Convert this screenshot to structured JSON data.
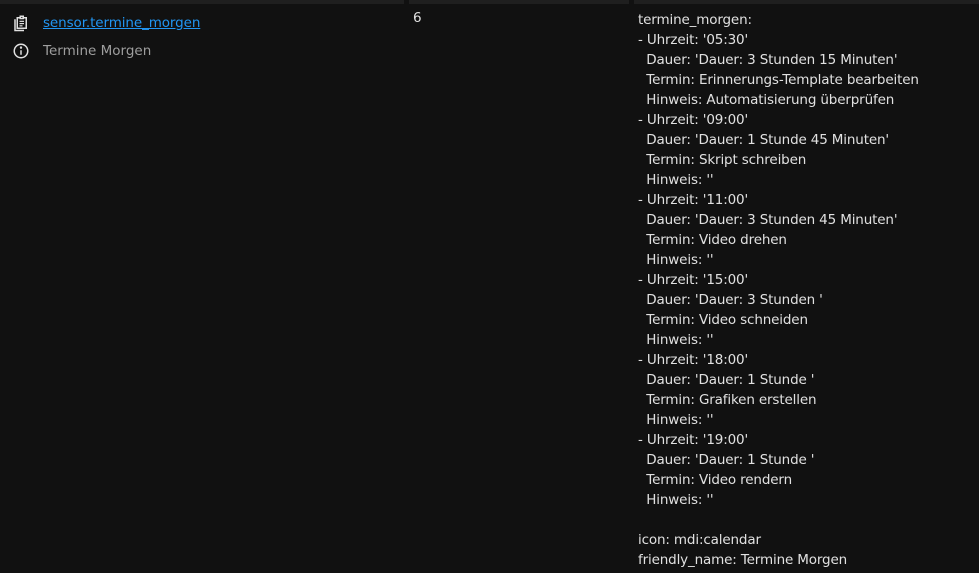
{
  "entity": {
    "id": "sensor.termine_morgen",
    "friendly_name": "Termine Morgen",
    "id_icon": "clipboard-list-icon",
    "name_icon": "info-circle-icon"
  },
  "state": "6",
  "attributes": {
    "lines": [
      "termine_morgen:",
      "- Uhrzeit: '05:30'",
      "  Dauer: 'Dauer: 3 Stunden 15 Minuten'",
      "  Termin: Erinnerungs-Template bearbeiten",
      "  Hinweis: Automatisierung überprüfen",
      "- Uhrzeit: '09:00'",
      "  Dauer: 'Dauer: 1 Stunde 45 Minuten'",
      "  Termin: Skript schreiben",
      "  Hinweis: ''",
      "- Uhrzeit: '11:00'",
      "  Dauer: 'Dauer: 3 Stunden 45 Minuten'",
      "  Termin: Video drehen",
      "  Hinweis: ''",
      "- Uhrzeit: '15:00'",
      "  Dauer: 'Dauer: 3 Stunden '",
      "  Termin: Video schneiden",
      "  Hinweis: ''",
      "- Uhrzeit: '18:00'",
      "  Dauer: 'Dauer: 1 Stunde '",
      "  Termin: Grafiken erstellen",
      "  Hinweis: ''",
      "- Uhrzeit: '19:00'",
      "  Dauer: 'Dauer: 1 Stunde '",
      "  Termin: Video rendern",
      "  Hinweis: ''",
      "",
      "icon: mdi:calendar",
      "friendly_name: Termine Morgen"
    ]
  },
  "colors": {
    "background": "#111111",
    "link": "#2196f3",
    "text": "#e1e1e1",
    "muted": "#9e9e9e"
  }
}
